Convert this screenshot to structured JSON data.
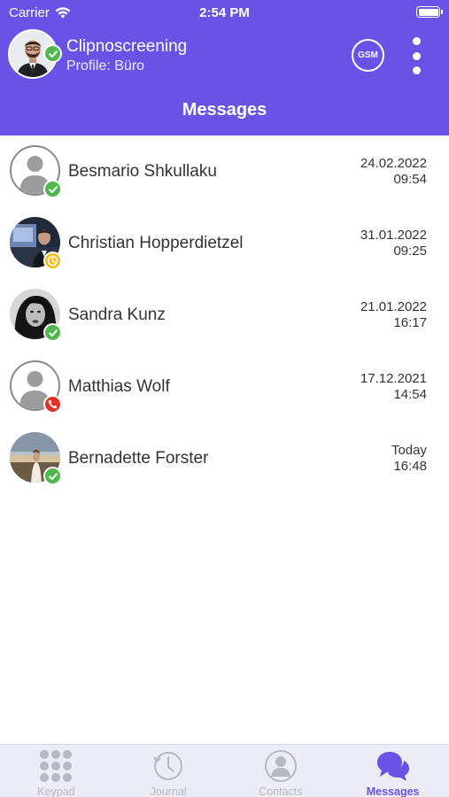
{
  "status_bar": {
    "carrier": "Carrier",
    "time": "2:54 PM"
  },
  "header": {
    "profile_name": "Clipnoscreening",
    "profile_line": "Profile: Büro",
    "gsm_label": "GSM",
    "title": "Messages",
    "accent": "#6b52e6"
  },
  "contacts": [
    {
      "name": "Besmario Shkullaku",
      "date": "24.02.2022",
      "time": "09:54",
      "status": "available",
      "avatar": "default-avatar"
    },
    {
      "name": "Christian Hopperdietzel",
      "date": "31.01.2022",
      "time": "09:25",
      "status": "away",
      "avatar": "photo"
    },
    {
      "name": "Sandra Kunz",
      "date": "21.01.2022",
      "time": "16:17",
      "status": "available",
      "avatar": "photo"
    },
    {
      "name": "Matthias Wolf",
      "date": "17.12.2021",
      "time": "14:54",
      "status": "busy",
      "avatar": "default-avatar"
    },
    {
      "name": "Bernadette Forster",
      "date": "Today",
      "time": "16:48",
      "status": "available",
      "avatar": "photo"
    }
  ],
  "tabs": [
    {
      "label": "Keypad",
      "icon": "keypad-icon",
      "active": false
    },
    {
      "label": "Journal",
      "icon": "clock-icon",
      "active": false
    },
    {
      "label": "Contacts",
      "icon": "contact-icon",
      "active": false
    },
    {
      "label": "Messages",
      "icon": "chat-bubbles-icon",
      "active": true
    }
  ]
}
